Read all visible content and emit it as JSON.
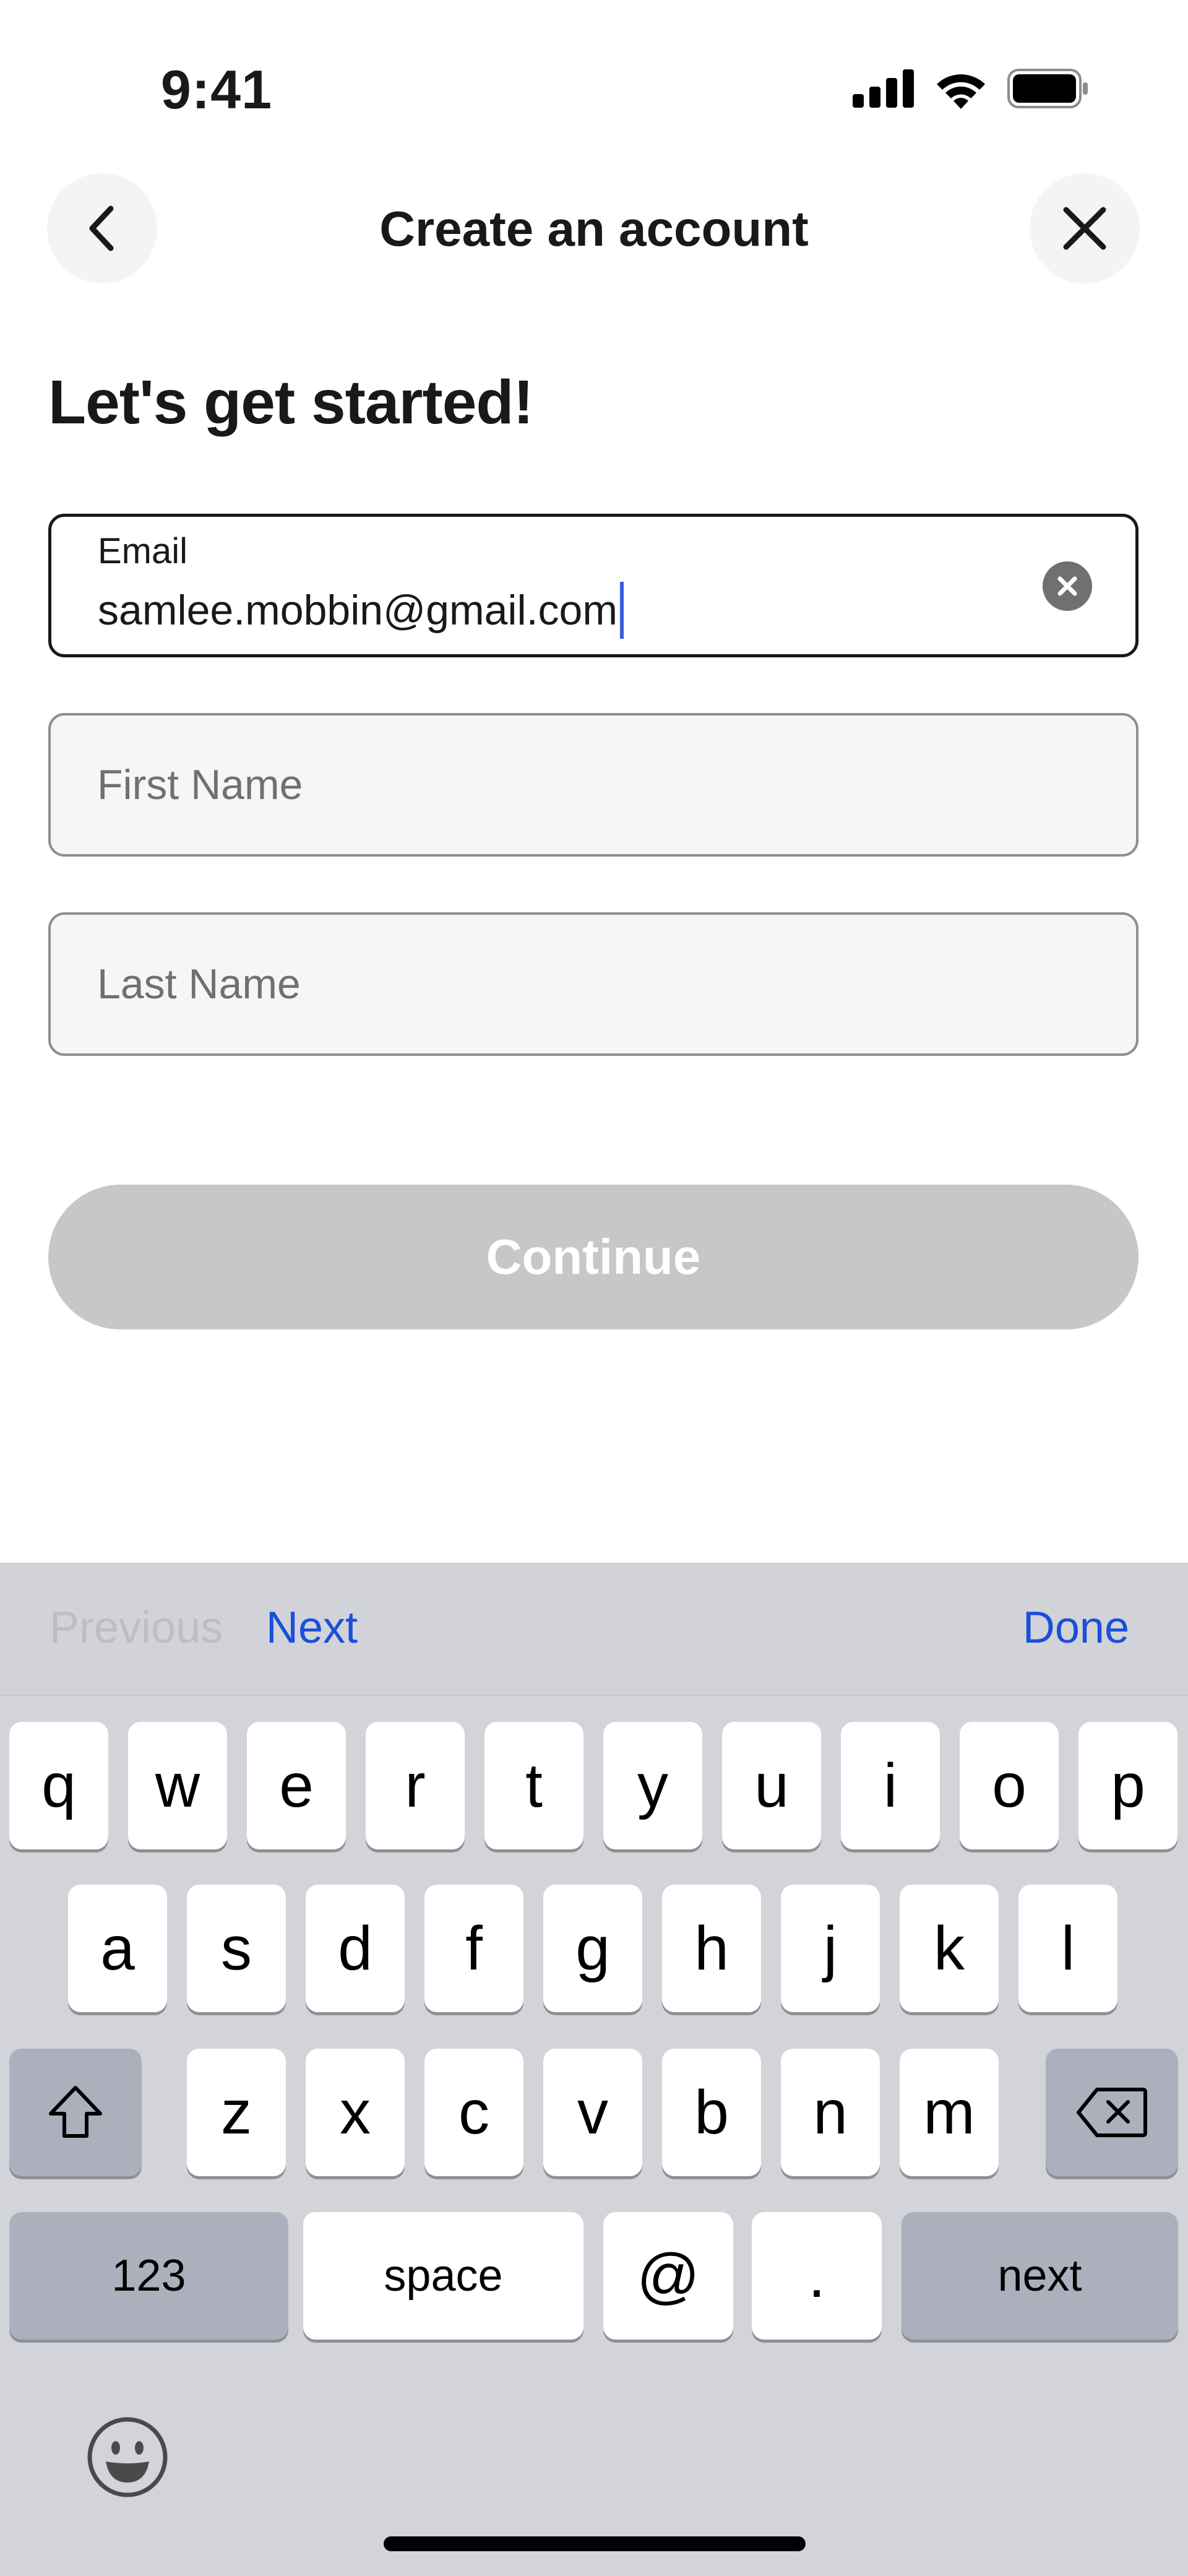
{
  "status_bar": {
    "time": "9:41"
  },
  "header": {
    "title": "Create an account"
  },
  "heading": "Let's get started!",
  "form": {
    "email": {
      "label": "Email",
      "value": "samlee.mobbin@gmail.com"
    },
    "first_name": {
      "placeholder": "First Name"
    },
    "last_name": {
      "placeholder": "Last Name"
    }
  },
  "continue_label": "Continue",
  "keyboard": {
    "accessory": {
      "previous": "Previous",
      "next": "Next",
      "done": "Done"
    },
    "row1": [
      "q",
      "w",
      "e",
      "r",
      "t",
      "y",
      "u",
      "i",
      "o",
      "p"
    ],
    "row2": [
      "a",
      "s",
      "d",
      "f",
      "g",
      "h",
      "j",
      "k",
      "l"
    ],
    "row3": [
      "z",
      "x",
      "c",
      "v",
      "b",
      "n",
      "m"
    ],
    "row4": {
      "numbers": "123",
      "space": "space",
      "at": "@",
      "dot": ".",
      "next": "next"
    }
  },
  "colors": {
    "accent": "#1a4fd9",
    "button_disabled": "#c7c7c7",
    "caret": "#3b5bdb"
  }
}
